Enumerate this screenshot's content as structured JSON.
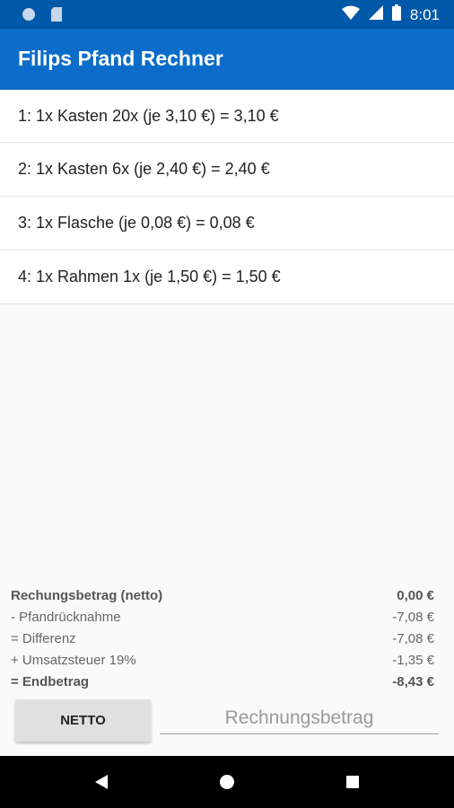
{
  "status_bar": {
    "time": "8:01"
  },
  "app_bar": {
    "title": "Filips Pfand Rechner"
  },
  "items": [
    {
      "text": "1: 1x Kasten 20x (je  3,10 €) =  3,10 €"
    },
    {
      "text": "2: 1x Kasten 6x (je  2,40 €) =  2,40 €"
    },
    {
      "text": "3: 1x Flasche (je  0,08 €) =  0,08 €"
    },
    {
      "text": "4: 1x Rahmen 1x (je  1,50 €) =  1,50 €"
    }
  ],
  "summary": [
    {
      "label": "Rechungsbetrag (netto)",
      "value": "0,00 €"
    },
    {
      "label": "- Pfandrücknahme",
      "value": "-7,08 €"
    },
    {
      "label": "= Differenz",
      "value": "-7,08 €"
    },
    {
      "label": "+ Umsatzsteuer 19%",
      "value": "-1,35 €"
    },
    {
      "label": "= Endbetrag",
      "value": "-8,43 €"
    }
  ],
  "controls": {
    "netto_label": "NETTO",
    "amount_placeholder": "Rechnungsbetrag",
    "amount_value": ""
  },
  "colors": {
    "status_bar": "#0058a8",
    "app_bar": "#0b6cc9"
  }
}
